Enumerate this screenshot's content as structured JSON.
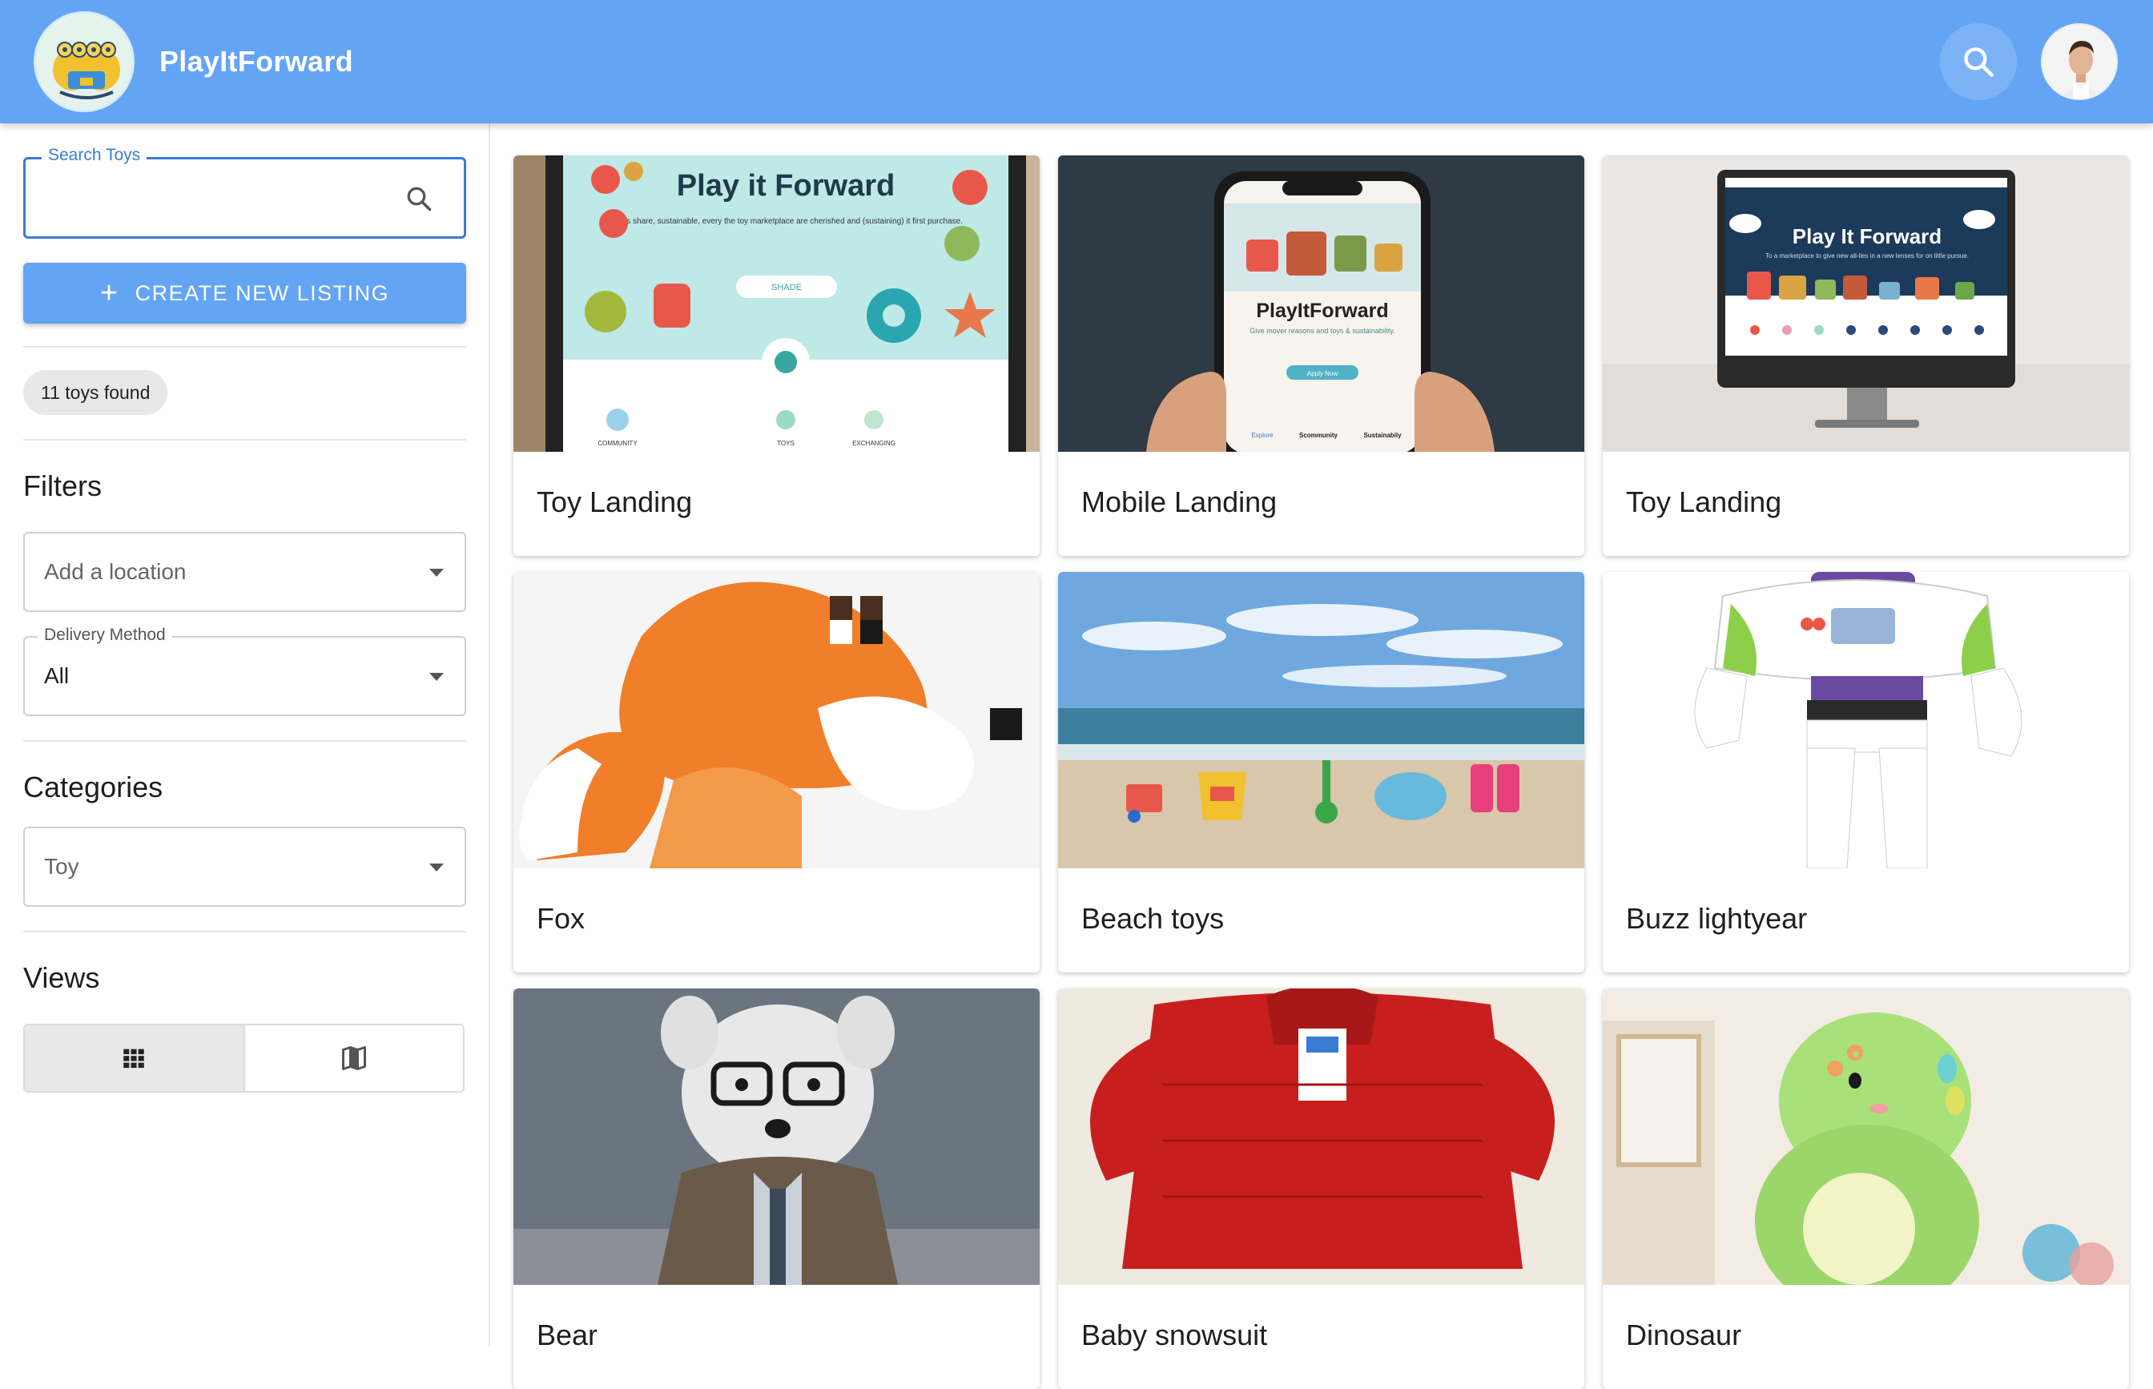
{
  "app": {
    "title": "PlayItForward",
    "accent": "#64a4f4"
  },
  "header": {
    "search_icon": "search-icon",
    "avatar_icon": "user-avatar"
  },
  "sidebar": {
    "search": {
      "label": "Search Toys",
      "value": "",
      "placeholder": ""
    },
    "create_button": "CREATE NEW LISTING",
    "count_chip": "11 toys found",
    "filters_title": "Filters",
    "location": {
      "placeholder": "Add a location"
    },
    "delivery": {
      "label": "Delivery Method",
      "value": "All"
    },
    "categories_title": "Categories",
    "category": {
      "value": "Toy"
    },
    "views_title": "Views",
    "views": [
      {
        "icon": "grid-view-icon",
        "active": true
      },
      {
        "icon": "map-view-icon",
        "active": false
      }
    ]
  },
  "listings": [
    {
      "title": "Toy Landing",
      "image_text": {
        "headline": "Play it Forward",
        "sub": "A toys share, sustainable, every the toy marketplace are cherished and (sustaining) it first purchase.",
        "button": "SHADE",
        "nav": [
          "COMMUNITY",
          "TOYS",
          "EXCHANGING"
        ]
      }
    },
    {
      "title": "Mobile Landing",
      "image_text": {
        "headline": "PlayItForward",
        "sub": "Give mover reasons and toys & sustainability.",
        "button": "Apply Now",
        "nav": [
          "Explore",
          "Scommunity",
          "Sustainabily"
        ]
      }
    },
    {
      "title": "Toy Landing",
      "image_text": {
        "headline": "Play It Forward",
        "sub": "To a marketplace to give new all-lies in a new lenses for on little pursue."
      }
    },
    {
      "title": "Fox"
    },
    {
      "title": "Beach toys"
    },
    {
      "title": "Buzz lightyear"
    },
    {
      "title": "Bear"
    },
    {
      "title": "Baby snowsuit"
    },
    {
      "title": "Dinosaur"
    }
  ]
}
